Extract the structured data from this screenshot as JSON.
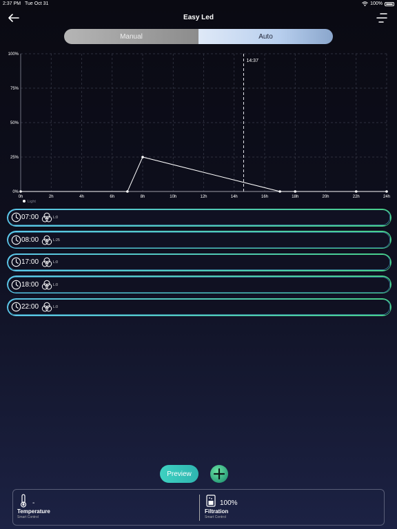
{
  "status": {
    "time": "2:37 PM",
    "date": "Tue Oct 31",
    "battery": "100%"
  },
  "header": {
    "title": "Easy Led",
    "back_icon": "arrow-left-icon",
    "menu_icon": "sort-menu-icon"
  },
  "mode_tabs": {
    "manual_label": "Manual",
    "auto_label": "Auto",
    "active": "Auto"
  },
  "chart_data": {
    "type": "line",
    "x_tick_labels": [
      "0h",
      "2h",
      "4h",
      "6h",
      "8h",
      "10h",
      "12h",
      "14h",
      "16h",
      "18h",
      "20h",
      "22h",
      "24h"
    ],
    "y_tick_labels": [
      "0%",
      "25%",
      "50%",
      "75%",
      "100%"
    ],
    "xlim": [
      0,
      24
    ],
    "ylim": [
      0,
      100
    ],
    "grid": true,
    "series": [
      {
        "name": "Light",
        "color": "#ffffff",
        "points": [
          [
            0,
            0
          ],
          [
            7,
            0
          ],
          [
            8,
            25
          ],
          [
            17,
            0
          ],
          [
            18,
            0
          ],
          [
            22,
            0
          ],
          [
            24,
            0
          ]
        ]
      }
    ],
    "current_time_marker": {
      "x": 14.62,
      "label": "14:37"
    },
    "legend": "bottom-left"
  },
  "schedule": [
    {
      "time": "07:00",
      "level": "L:0"
    },
    {
      "time": "08:00",
      "level": "L:25"
    },
    {
      "time": "17:00",
      "level": "L:0"
    },
    {
      "time": "18:00",
      "level": "L:0"
    },
    {
      "time": "22:00",
      "level": "L:0"
    }
  ],
  "actions": {
    "preview_label": "Preview",
    "add_icon": "plus-icon"
  },
  "panel": {
    "temperature": {
      "value": "-",
      "label": "Temperature",
      "sub": "Smart Control"
    },
    "filtration": {
      "value": "100%",
      "label": "Filtration",
      "sub": "Smart Control"
    }
  },
  "colors": {
    "accent_teal": "#3ed1c1",
    "accent_green": "#47cf8a",
    "border_blue": "#5cc7ea"
  }
}
